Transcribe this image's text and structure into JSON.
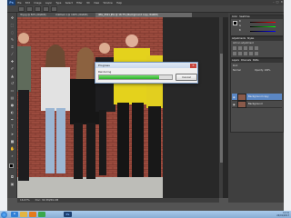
{
  "app": {
    "logo": "Ps",
    "menu": [
      "File",
      "Edit",
      "Image",
      "Layer",
      "Type",
      "Select",
      "Filter",
      "3D",
      "View",
      "Window",
      "Help"
    ],
    "window_controls": [
      "–",
      "□",
      "✕"
    ]
  },
  "document_tabs": [
    {
      "label": "3t.jpg @ 50% (RGB/8)",
      "active": false
    },
    {
      "label": "Untitled-1 @ 100% (RGB/8)",
      "active": false
    },
    {
      "label": "IMG_4521.JPG @ 16.7% (Background copy, RGB/8)",
      "active": true
    }
  ],
  "status_bar": {
    "zoom": "16.67%",
    "doc": "Doc: 34.5M/69.0M"
  },
  "progress_dialog": {
    "title": "Progress",
    "message": "Rendering",
    "progress": 0.82,
    "cancel_label": "Cancel",
    "close_glyph": "✕"
  },
  "panels": {
    "color": {
      "tabs": [
        "Color",
        "Swatches"
      ],
      "channels": [
        "R",
        "G",
        "B"
      ]
    },
    "adjustments": {
      "tabs": [
        "Adjustments",
        "Styles"
      ],
      "title": "Add an adjustment"
    },
    "layers": {
      "tabs": [
        "Layers",
        "Channels",
        "Paths"
      ],
      "kind_label": "Kind",
      "blend_mode": "Normal",
      "opacity_label": "Opacity: 100%",
      "items": [
        {
          "name": "Background copy",
          "selected": true
        },
        {
          "name": "Background",
          "selected": false
        }
      ]
    }
  },
  "taskbar": {
    "apps": [
      "IE",
      "Explorer",
      "Media",
      "Chrome",
      "Ps"
    ],
    "time": "12:41",
    "date": "24/01/2017"
  },
  "colors": {
    "accent_selection": "#5b87c4",
    "progress_green": "#2fae2b",
    "ps_blue": "#1b3e6e"
  }
}
